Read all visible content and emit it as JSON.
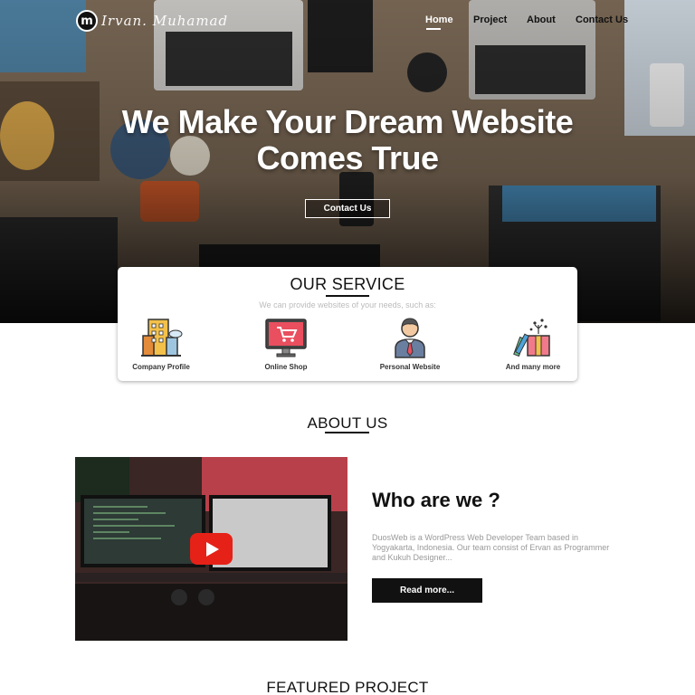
{
  "brand": {
    "logo_letter": "m",
    "logo_script": "Irvan. Muhamad"
  },
  "nav": {
    "items": [
      "Home",
      "Project",
      "About",
      "Contact Us"
    ],
    "active": "Home"
  },
  "hero": {
    "title_line1": "We Make Your Dream Website",
    "title_line2": "Comes True",
    "cta_label": "Contact Us"
  },
  "service": {
    "title": "OUR SERVICE",
    "subtitle": "We can provide websites of your needs, such as:",
    "items": [
      {
        "label": "Company Profile",
        "icon": "building-icon"
      },
      {
        "label": "Online Shop",
        "icon": "shopping-cart-monitor-icon"
      },
      {
        "label": "Personal Website",
        "icon": "businessman-icon"
      },
      {
        "label": "And many more",
        "icon": "gift-box-icon"
      }
    ]
  },
  "about": {
    "title": "ABOUT US",
    "heading": "Who are we ?",
    "description": "DuosWeb is a WordPress Web Developer Team based in Yogyakarta, Indonesia. Our team consist of Ervan as Programmer and Kukuh Designer...",
    "read_more": "Read more..."
  },
  "featured": {
    "title": "FEATURED PROJECT"
  },
  "colors": {
    "accent": "#111111",
    "play_red": "#e62117",
    "hero_text": "#ffffff"
  }
}
